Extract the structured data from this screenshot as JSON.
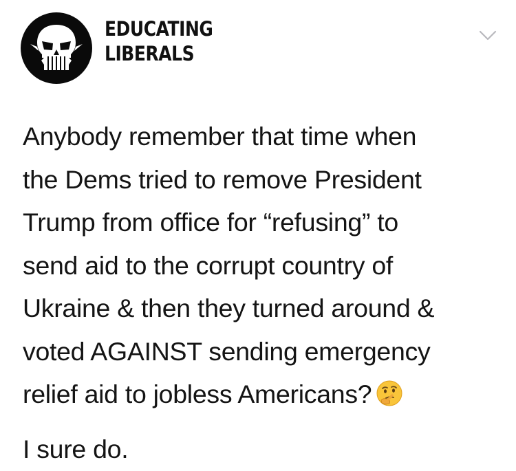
{
  "account": {
    "name_line1": "EDUCATING",
    "name_line2": "LIBERALS",
    "avatar_icon": "punisher-skull-icon",
    "menu_icon": "chevron-down-icon"
  },
  "tweet": {
    "lines": [
      "Anybody remember that time when",
      "the Dems tried to remove President",
      "Trump from office for “refusing” to",
      "send aid to the corrupt country of",
      "Ukraine & then they turned around &",
      "voted AGAINST sending emergency",
      "relief aid to jobless Americans?"
    ],
    "emoji": "thinking-face-emoji",
    "closing": "I sure do."
  },
  "colors": {
    "background": "#ffffff",
    "text": "#141414",
    "avatar_bg": "#0a0a0a",
    "chevron": "#b8b8bd"
  }
}
